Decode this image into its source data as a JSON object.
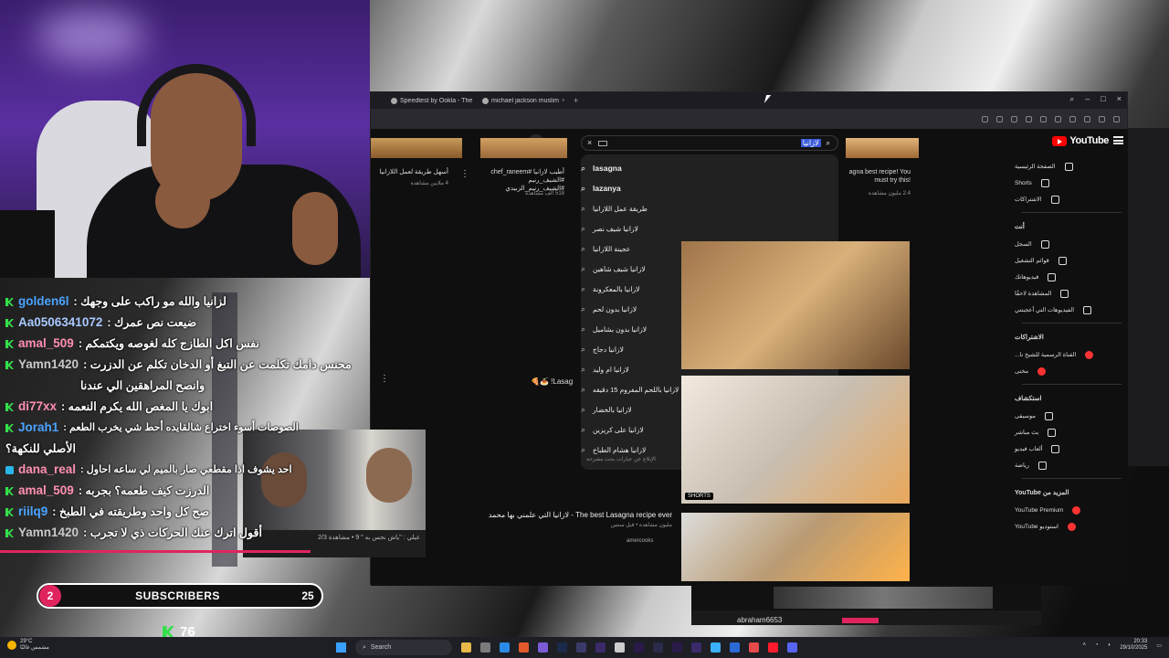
{
  "browser": {
    "tabs": [
      {
        "label": "Speedtest by Ookla - The"
      },
      {
        "label": "michael jackson muslim"
      }
    ]
  },
  "youtube": {
    "logo_text": "YouTube",
    "search_query": "لازانيا",
    "suggestions": [
      "lasagna",
      "lazanya",
      "طريقة عمل اللازانيا",
      "لازانيا شيف نصر",
      "عجينة اللازانيا",
      "لازانيا شيف شاهين",
      "لازانيا بالمعكرونة",
      "لازانيا بدون لحم",
      "لازانيا بدون بشاميل",
      "لازانيا دجاج",
      "لازانيا ام وليد",
      "لازانيا باللحم المفروم 15 دقيقه",
      "لازانيا بالخضار",
      "لازانيا على كريزين",
      "لازانيا هشام الطباخ"
    ],
    "suggestions_footer": "الإبلاغ عن عبارات بحث مقترحة",
    "sidebar": {
      "main": [
        "الصفحة الرئيسية",
        "Shorts",
        "الاشتراكات"
      ],
      "you_header": "أنت",
      "you": [
        "السجل",
        "قوائم التشغيل",
        "فيديوهاتك",
        "المشاهدة لاحقًا",
        "الفيديوهات التي أعجبتني"
      ],
      "subs_header": "الاشتراكات",
      "subs": [
        "القناة الرسمية للشيخ نا...",
        "مخنى"
      ],
      "explore_header": "استكشاف",
      "explore": [
        "موسيقى",
        "بث مباشر",
        "ألعاب فيديو",
        "رياضة"
      ],
      "more_header": "المزيد من YouTube",
      "more": [
        "YouTube Premium",
        "استوديو YouTube"
      ]
    },
    "top_videos": [
      {
        "title": "أسهل طريقة لعمل اللازانيا",
        "meta": "4 ملايين مشاهدة"
      },
      {
        "title": "أطيب لازانيا #chef_raneem #الشيف_رنيم #الشيف_رنيم_الزبيدي",
        "meta": "518 ألف مشاهدة"
      },
      {
        "title": "agna best recipe! You must try this!",
        "meta": "2.4 مليون مشاهدة"
      }
    ],
    "shorts_label": "SHORTS",
    "lasagna_label": "Lasag",
    "featured": {
      "title": "The best Lasagna recipe ever - لازانيا التي علمني بها محمد",
      "meta": "مليون مشاهدة • قبل سنتين",
      "channel": "amercooks"
    }
  },
  "stream": {
    "chat": [
      {
        "user": "golden6l",
        "user_color": "#4aa3ff",
        "msg": "لزانيا والله مو راكب على وجهك"
      },
      {
        "user": "Aa0506341072",
        "user_color": "#a8c8ff",
        "msg": "ضيعت نص عمرك"
      },
      {
        "user": "amal_509",
        "user_color": "#ff8fb0",
        "msg": "نفس اكل الطازج كله لغوصه ويكتمكم"
      },
      {
        "user": "Yamn1420",
        "user_color": "#c8c8c8",
        "msg": "محنس دامك تكلمت عن التبغ أو الدخان تكلم عن الدزرت"
      },
      {
        "user": "",
        "user_color": "#c8c8c8",
        "msg": "وانصح المراهقين الي عندنا"
      },
      {
        "user": "di77xx",
        "user_color": "#ff8fb0",
        "msg": "ابوك يا المغص الله يكرم النعمه"
      },
      {
        "user": "Jorah1",
        "user_color": "#4aa3ff",
        "msg": "الصوصات أسوء اختراع شالقايده أحط شي يخرب الطعم"
      },
      {
        "user": "",
        "user_color": "#4aa3ff",
        "msg": "الأصلي للنكهة؟"
      },
      {
        "user": "dana_real",
        "user_color": "#ff8fb0",
        "msg": "احد يشوف اذا مقطعي صار بالميم لي ساعه احاول"
      },
      {
        "user": "amal_509",
        "user_color": "#ff8fb0",
        "msg": "الدرزت كيف طعمه؟ بجربه"
      },
      {
        "user": "riilq9",
        "user_color": "#4aa3ff",
        "msg": "صح كل واحد وطريقته في الطبخ"
      },
      {
        "user": "Yamn1420",
        "user_color": "#c8c8c8",
        "msg": "أقول اترك عنك الحركات ذي لا تجرب"
      }
    ],
    "subs_bar": {
      "count": "2",
      "label": "SUBSCRIBERS",
      "goal": "25"
    },
    "kick_count": "76",
    "clip_caption": "عيلي : \"ياش نحس به \" 9 • مشاهدة 2/3",
    "player_name": "abraham6653"
  },
  "taskbar": {
    "search_placeholder": "Search",
    "weather_temp": "29°C",
    "weather_desc": "مشمس غالبًا",
    "time": "20:33",
    "date": "29/10/2025"
  }
}
